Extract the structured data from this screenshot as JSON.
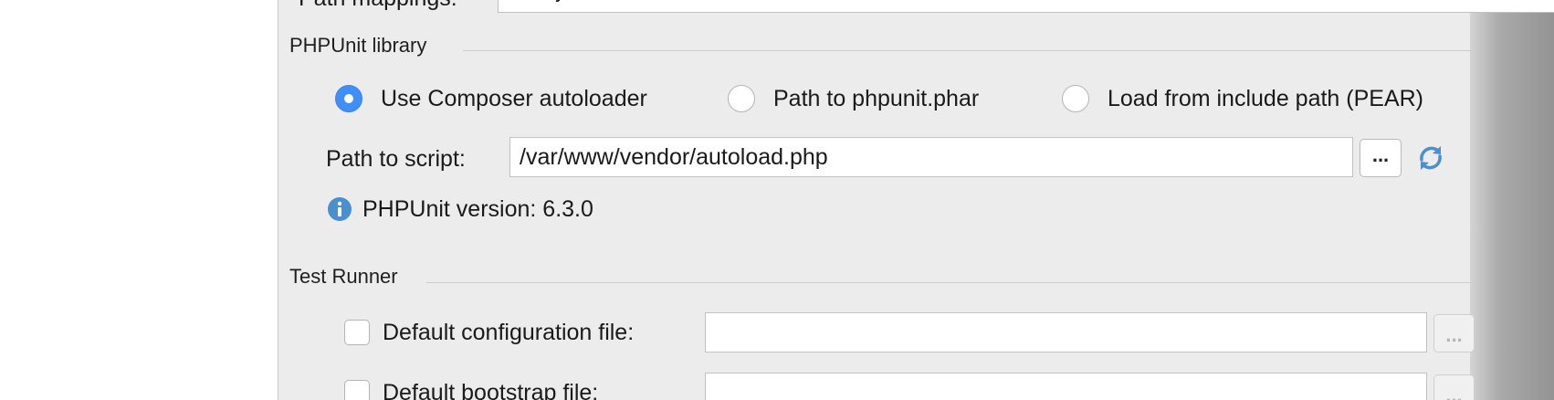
{
  "path_mappings": {
    "label": "Path mappings:",
    "value": "<Project root>→/var/www",
    "browse_label": "..."
  },
  "phpunit_library": {
    "title": "PHPUnit library",
    "options": [
      {
        "label": "Use Composer autoloader",
        "selected": true
      },
      {
        "label": "Path to phpunit.phar",
        "selected": false
      },
      {
        "label": "Load from include path (PEAR)",
        "selected": false
      }
    ],
    "path_to_script_label": "Path to script:",
    "path_to_script_value": "/var/www/vendor/autoload.php",
    "browse_label": "...",
    "version_text": "PHPUnit version: 6.3.0"
  },
  "test_runner": {
    "title": "Test Runner",
    "default_config_label": "Default configuration file:",
    "default_config_value": "",
    "default_bootstrap_label": "Default bootstrap file:",
    "default_bootstrap_value": "",
    "browse_label": "..."
  },
  "colors": {
    "accent": "#3f8ef9",
    "dialog_bg": "#ececec",
    "info_icon": "#4a8fd0"
  }
}
